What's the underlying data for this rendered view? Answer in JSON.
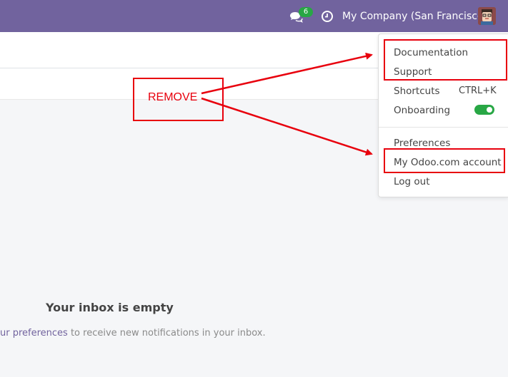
{
  "navbar": {
    "message_count": "6",
    "company": "My Company (San Francisco)"
  },
  "inbox": {
    "empty_title": "Your inbox is empty",
    "hint_link": "ur preferences",
    "hint_rest": " to receive new notifications in your inbox."
  },
  "user_menu": {
    "documentation": "Documentation",
    "support": "Support",
    "shortcuts": "Shortcuts",
    "shortcuts_key": "CTRL+K",
    "onboarding": "Onboarding",
    "onboarding_enabled": true,
    "preferences": "Preferences",
    "odoo_account": "My Odoo.com account",
    "logout": "Log out"
  },
  "annotation": {
    "label": "REMOVE",
    "color": "#e8000d"
  },
  "colors": {
    "navbar": "#71639e",
    "toggle_on": "#28a745"
  }
}
